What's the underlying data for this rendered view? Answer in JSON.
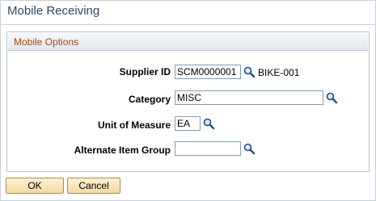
{
  "page": {
    "title": "Mobile Receiving"
  },
  "group": {
    "title": "Mobile Options"
  },
  "fields": {
    "supplier_id": {
      "label": "Supplier ID",
      "value": "SCM0000001",
      "description": "BIKE-001"
    },
    "category": {
      "label": "Category",
      "value": "MISC"
    },
    "unit_of_measure": {
      "label": "Unit of Measure",
      "value": "EA"
    },
    "alternate_item_group": {
      "label": "Alternate Item Group",
      "value": ""
    }
  },
  "buttons": {
    "ok": "OK",
    "cancel": "Cancel"
  },
  "icons": {
    "lookup": "magnifier-lookup-icon"
  }
}
